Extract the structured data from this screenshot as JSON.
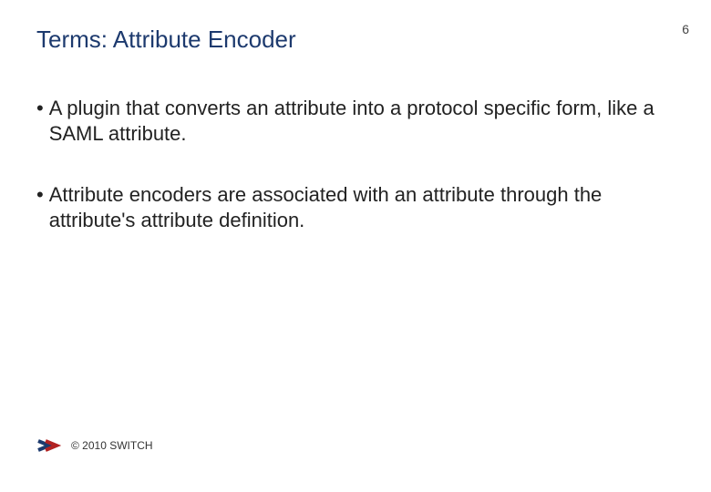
{
  "title": "Terms: Attribute Encoder",
  "page_number": "6",
  "bullets": [
    "A plugin that converts an attribute into a protocol specific form, like a SAML attribute.",
    "Attribute encoders are associated with an attribute through the attribute's attribute definition."
  ],
  "footer": {
    "copyright": "© 2010 SWITCH"
  },
  "colors": {
    "title": "#1d3a6e",
    "logo_blue": "#1d3a6e",
    "logo_red": "#b22222"
  }
}
